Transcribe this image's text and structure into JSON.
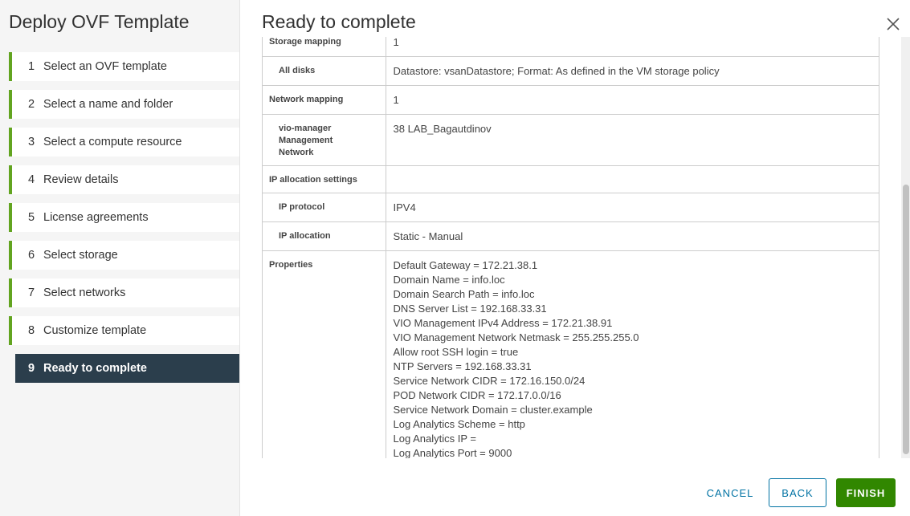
{
  "wizard": {
    "title": "Deploy OVF Template",
    "steps": [
      {
        "num": "1",
        "label": "Select an OVF template"
      },
      {
        "num": "2",
        "label": "Select a name and folder"
      },
      {
        "num": "3",
        "label": "Select a compute resource"
      },
      {
        "num": "4",
        "label": "Review details"
      },
      {
        "num": "5",
        "label": "License agreements"
      },
      {
        "num": "6",
        "label": "Select storage"
      },
      {
        "num": "7",
        "label": "Select networks"
      },
      {
        "num": "8",
        "label": "Customize template"
      },
      {
        "num": "9",
        "label": "Ready to complete"
      }
    ],
    "active_step": "9"
  },
  "main": {
    "title": "Ready to complete",
    "rows": {
      "storage_mapping": {
        "label": "Storage mapping",
        "value": "1"
      },
      "all_disks": {
        "label": "All disks",
        "value": "Datastore: vsanDatastore; Format: As defined in the VM storage policy"
      },
      "network_mapping": {
        "label": "Network mapping",
        "value": "1"
      },
      "vio_network": {
        "label_lines": [
          "vio-manager",
          "Management",
          "Network"
        ],
        "value": "38 LAB_Bagautdinov"
      },
      "ip_allocation_settings": {
        "label": "IP allocation settings",
        "value": ""
      },
      "ip_protocol": {
        "label": "IP protocol",
        "value": "IPV4"
      },
      "ip_allocation": {
        "label": "IP allocation",
        "value": "Static - Manual"
      },
      "properties": {
        "label": "Properties",
        "lines": [
          "Default Gateway = 172.21.38.1",
          "Domain Name = info.loc",
          "Domain Search Path = info.loc",
          "DNS Server List = 192.168.33.31",
          "VIO Management IPv4 Address = 172.21.38.91",
          "VIO Management Network Netmask = 255.255.255.0",
          "Allow root SSH login = true",
          "NTP Servers = 192.168.33.31",
          "Service Network CIDR = 172.16.150.0/24",
          "POD Network CIDR = 172.17.0.0/16",
          "Service Network Domain = cluster.example",
          "Log Analytics Scheme = http",
          "Log Analytics IP =",
          "Log Analytics Port = 9000"
        ]
      }
    }
  },
  "footer": {
    "cancel_label": "CANCEL",
    "back_label": "BACK",
    "finish_label": "FINISH"
  },
  "icons": {
    "close": "close-icon"
  },
  "colors": {
    "step_accent": "#62a420",
    "active_step_bg": "#2b3e4c",
    "link_blue": "#0072a3",
    "finish_green": "#318700"
  }
}
